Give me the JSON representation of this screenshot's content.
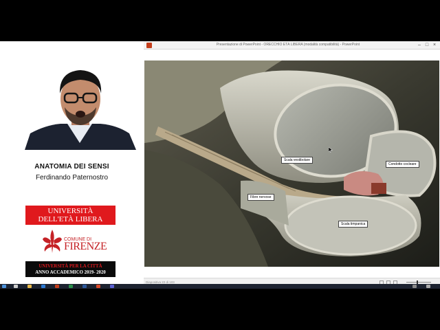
{
  "presenter": {
    "course_title": "ANATOMIA DEI SENSI",
    "lecturer_name": "Ferdinando Paternostro"
  },
  "logos": {
    "universita_line1": "UNIVERSITÀ",
    "universita_line2": "DELL'ETÀ LIBERA",
    "comune_label": "COMUNE DI",
    "firenze_label": "FIRENZE",
    "banner_line1": "UNIVERSITÀ PER LA CITTÀ",
    "banner_line2": "ANNO ACCADEMICO 2019- 2020"
  },
  "window": {
    "title": "Presentazione di PowerPoint - ORECCHIO ETÀ LIBERA (modalità compatibilità) - PowerPoint",
    "minimize_icon": "minimize-icon",
    "maximize_icon": "maximize-icon",
    "close_icon": "close-icon"
  },
  "slide": {
    "labels": {
      "scala_vestibolare": "Scala vestibolare",
      "condotto_cocleare": "Condotto cocleare",
      "fibre_nervose": "Fibre nervose",
      "scala_timpanica": "Scala timpanica"
    }
  },
  "statusbar": {
    "slide_counter": "Diapositiva 22 di 103"
  },
  "colors": {
    "unive_red": "#e0191d",
    "firenze_red": "#c52226",
    "ppt_accent": "#c43e1c"
  }
}
